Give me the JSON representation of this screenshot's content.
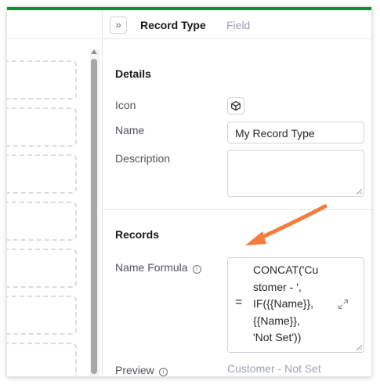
{
  "header": {
    "collapse_glyph": "»",
    "tabs": [
      {
        "label": "Record Type",
        "active": true
      },
      {
        "label": "Field",
        "active": false
      }
    ]
  },
  "details": {
    "title": "Details",
    "icon_label": "Icon",
    "icon_value": "cube-icon",
    "name_label": "Name",
    "name_value": "My Record Type",
    "description_label": "Description",
    "description_value": ""
  },
  "records": {
    "title": "Records",
    "name_formula_label": "Name Formula",
    "formula_lines": [
      "CONCAT('Cu",
      "stomer - ',",
      "IF({{Name}},",
      "{{Name}},",
      "'Not Set'))"
    ],
    "equals_glyph": "=",
    "preview_label": "Preview",
    "preview_value": "Customer - Not Set"
  },
  "colors": {
    "accent_bar": "#1a8a3a",
    "arrow": "#f47c3c"
  }
}
